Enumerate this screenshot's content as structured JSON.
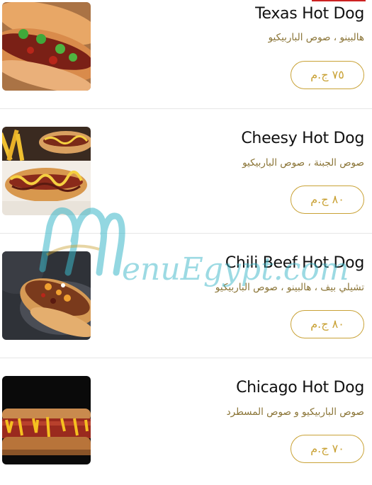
{
  "menu": {
    "items": [
      {
        "name": "Texas Hot Dog",
        "description": "هالبينو ، صوص الباربيكيو",
        "price": "٧٥ ج.م",
        "image": "texas-hot-dog-photo"
      },
      {
        "name": "Cheesy Hot Dog",
        "description": "صوص الجبنة ، صوص الباربيكيو",
        "price": "٨٠ ج.م",
        "image": "cheesy-hot-dog-photo"
      },
      {
        "name": "Chili Beef Hot Dog",
        "description": "تشيلي بيف ، هالبينو ، صوص الباربيكيو",
        "price": "٨٠ ج.م",
        "image": "chili-beef-hot-dog-photo"
      },
      {
        "name": "Chicago Hot Dog",
        "description": "صوص الباربيكيو و صوص المسطرد",
        "price": "٧٠ ج.م",
        "image": "chicago-hot-dog-photo"
      }
    ]
  },
  "watermark": {
    "text": "enuEgypt.com",
    "brand_colors": {
      "teal": "#3bb7c9",
      "gold": "#c9a236"
    }
  }
}
